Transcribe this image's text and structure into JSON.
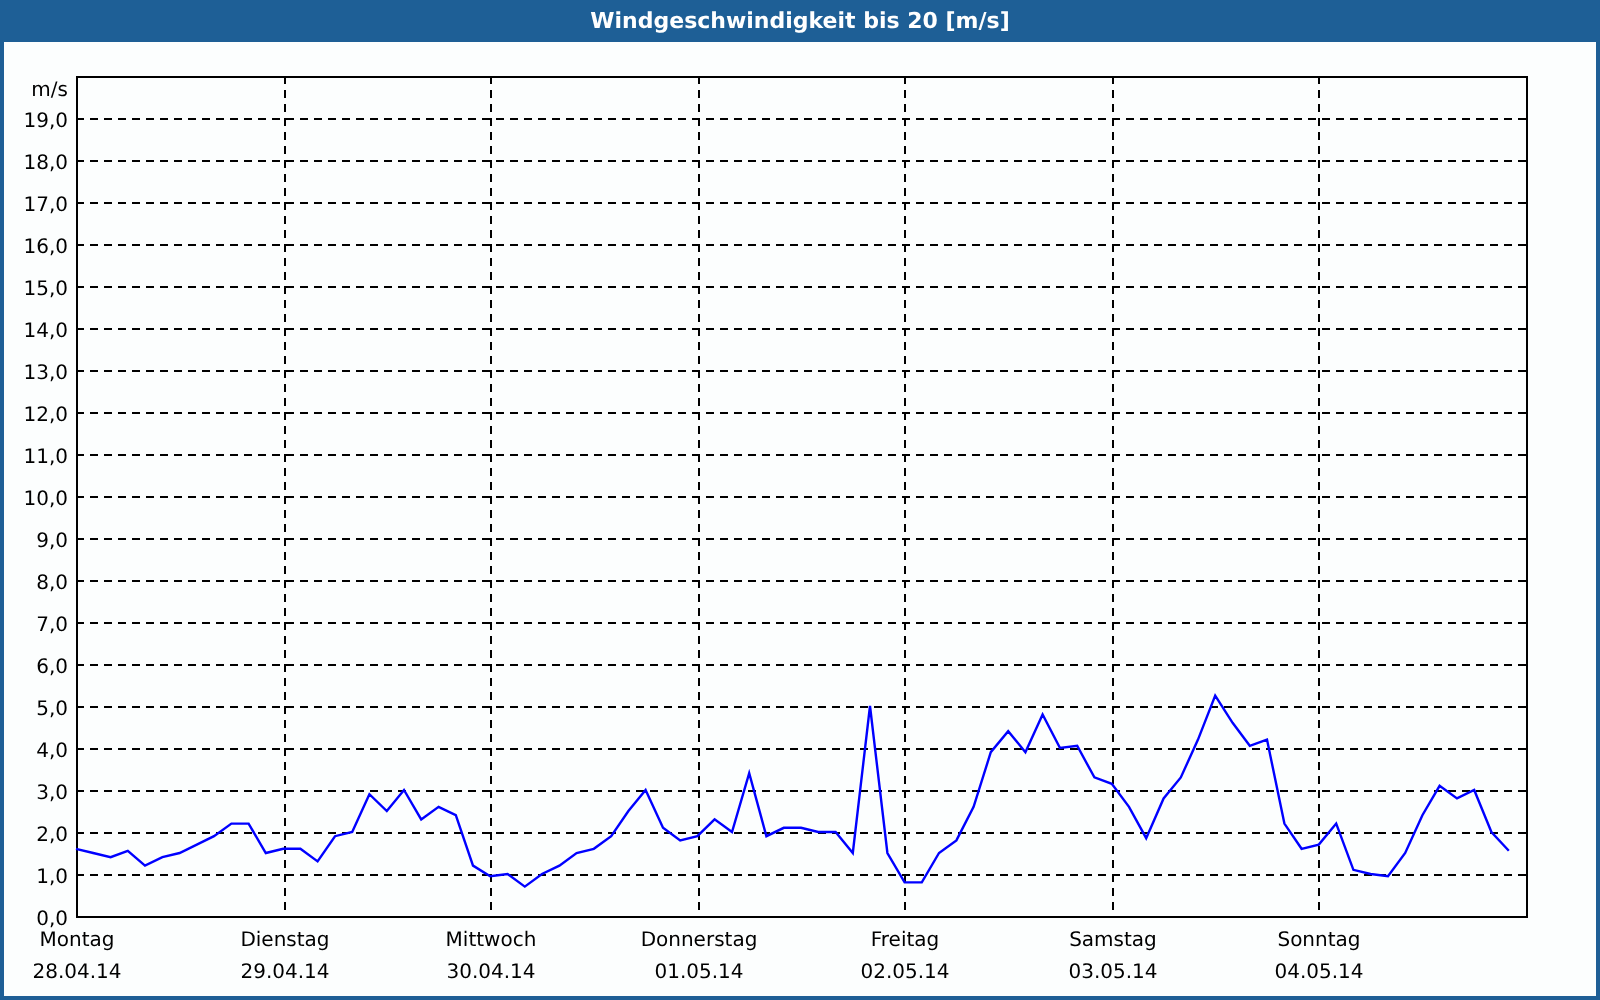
{
  "window": {
    "title": "Windgeschwindigkeit bis 20 [m/s]"
  },
  "chart": {
    "chart_data": {
      "type": "line",
      "grid": true,
      "ylabel": "m/s",
      "ylim": [
        0,
        20
      ],
      "categories": [
        "Montag\n28.04.14",
        null,
        null,
        null,
        null,
        null,
        null,
        null,
        null,
        null,
        null,
        null,
        "Dienstag\n29.04.14",
        null,
        null,
        null,
        null,
        null,
        null,
        null,
        null,
        null,
        null,
        null,
        "Mittwoch\n30.04.14",
        null,
        null,
        null,
        null,
        null,
        null,
        null,
        null,
        null,
        null,
        null,
        "Donnerstag\n01.05.14",
        null,
        null,
        null,
        null,
        null,
        null,
        null,
        null,
        null,
        null,
        null,
        "Freitag\n02.05.14",
        null,
        null,
        null,
        null,
        null,
        null,
        null,
        null,
        null,
        null,
        null,
        "Samstag\n03.05.14",
        null,
        null,
        null,
        null,
        null,
        null,
        null,
        null,
        null,
        null,
        null,
        "Sonntag\n04.05.14",
        null,
        null,
        null,
        null,
        null,
        null,
        null,
        null,
        null,
        null,
        null
      ],
      "yticks": [
        {
          "value": 0,
          "label": "0,0"
        },
        {
          "value": 1,
          "label": "1,0"
        },
        {
          "value": 2,
          "label": "2,0"
        },
        {
          "value": 3,
          "label": "3,0"
        },
        {
          "value": 4,
          "label": "4,0"
        },
        {
          "value": 5,
          "label": "5,0"
        },
        {
          "value": 6,
          "label": "6,0"
        },
        {
          "value": 7,
          "label": "7,0"
        },
        {
          "value": 8,
          "label": "8,0"
        },
        {
          "value": 9,
          "label": "9,0"
        },
        {
          "value": 10,
          "label": "10,0"
        },
        {
          "value": 11,
          "label": "11,0"
        },
        {
          "value": 12,
          "label": "12,0"
        },
        {
          "value": 13,
          "label": "13,0"
        },
        {
          "value": 14,
          "label": "14,0"
        },
        {
          "value": 15,
          "label": "15,0"
        },
        {
          "value": 16,
          "label": "16,0"
        },
        {
          "value": 17,
          "label": "17,0"
        },
        {
          "value": 18,
          "label": "18,0"
        },
        {
          "value": 19,
          "label": "19,0"
        }
      ],
      "series": [
        {
          "color": "#0000ff",
          "values": [
            1.6,
            1.5,
            1.4,
            1.55,
            1.2,
            1.4,
            1.5,
            1.7,
            1.9,
            2.2,
            2.2,
            1.5,
            1.6,
            1.6,
            1.3,
            1.9,
            2.0,
            2.9,
            2.5,
            3.0,
            2.3,
            2.6,
            2.4,
            1.2,
            0.95,
            1.0,
            0.7,
            1.0,
            1.2,
            1.5,
            1.6,
            1.9,
            2.5,
            3.0,
            2.1,
            1.8,
            1.9,
            2.3,
            2.0,
            3.4,
            1.9,
            2.1,
            2.1,
            2.0,
            2.0,
            1.5,
            5.0,
            1.5,
            0.8,
            0.8,
            1.5,
            1.8,
            2.6,
            3.9,
            4.4,
            3.9,
            4.8,
            4.0,
            4.05,
            3.3,
            3.15,
            2.6,
            1.85,
            2.8,
            3.3,
            4.2,
            5.25,
            4.6,
            4.05,
            4.2,
            2.2,
            1.6,
            1.7,
            2.2,
            1.1,
            1.0,
            0.95,
            1.5,
            2.4,
            3.1,
            2.8,
            3.0,
            2.0,
            1.55
          ]
        }
      ]
    }
  }
}
